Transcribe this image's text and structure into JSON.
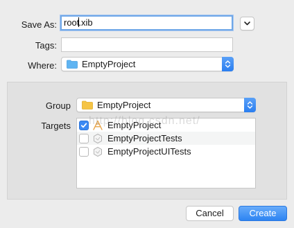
{
  "save_as": {
    "label": "Save As:",
    "value": "root.xib"
  },
  "tags": {
    "label": "Tags:",
    "value": ""
  },
  "where": {
    "label": "Where:",
    "value": "EmptyProject"
  },
  "group": {
    "label": "Group",
    "value": "EmptyProject"
  },
  "targets": {
    "label": "Targets",
    "items": [
      {
        "name": "EmptyProject",
        "checked": true,
        "icon": "app-target-icon"
      },
      {
        "name": "EmptyProjectTests",
        "checked": false,
        "icon": "test-bundle-icon"
      },
      {
        "name": "EmptyProjectUITests",
        "checked": false,
        "icon": "test-bundle-icon"
      }
    ]
  },
  "buttons": {
    "cancel": "Cancel",
    "create": "Create"
  },
  "watermark": "http://blog.csdn.net/",
  "colors": {
    "accent": "#2d84f2",
    "folder": "#5fb4f2",
    "group_folder": "#f5c445"
  }
}
